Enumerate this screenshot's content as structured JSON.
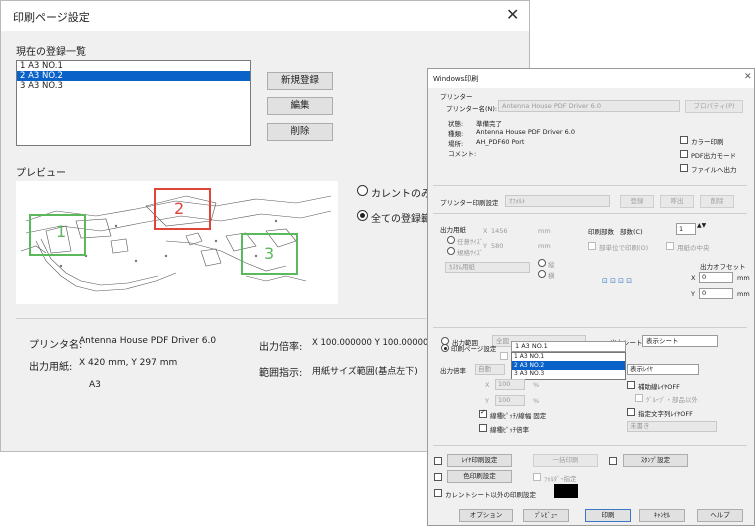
{
  "dialog_main": {
    "title": "印刷ページ設定",
    "close_icon": "close-icon",
    "list_heading": "現在の登録一覧",
    "list_items": [
      "1  A3  NO.1",
      "2  A3  NO.2",
      "3  A3  NO.3"
    ],
    "selected_index": 1,
    "buttons": {
      "new": "新規登録",
      "edit": "編集",
      "delete": "削除"
    },
    "preview_label": "プレビュー",
    "radio_current_only": "カレントのみ表",
    "radio_all": "全ての登録範",
    "markers": [
      "1",
      "2",
      "3"
    ],
    "marker_colors": {
      "1": "#5cb85c",
      "2": "#e0453a",
      "3": "#5cb85c"
    },
    "info": {
      "printer_label": "プリンタ名:",
      "printer_value": "Antenna House PDF Driver 6.0",
      "paper_label": "出力用紙:",
      "paper_value": "X 420 mm, Y 297 mm",
      "paper_size": "A3",
      "scale_label": "出力倍率:",
      "scale_value": "X 100.000000 Y 100.000000",
      "range_label": "範囲指示:",
      "range_value": "用紙サイズ範囲(基点左下)"
    }
  },
  "dialog_print": {
    "title": "Windows印刷",
    "close_icon": "close-icon",
    "printer_group": "プリンター",
    "printer_name_label": "プリンター名(N):",
    "printer_name_value": "Antenna House PDF Driver 6.0",
    "properties_button": "プロパティ(P)",
    "status_label": "状態:",
    "status_value": "準備完了",
    "type_label": "種類:",
    "type_value": "Antenna House PDF Driver 6.0",
    "location_label": "場所:",
    "location_value": "AH_PDF60 Port",
    "comment_label": "コメント:",
    "check_color": "カラー印刷",
    "check_pdf": "PDF出力モード",
    "check_file": "ファイルへ出力",
    "printer_preset_label": "プリンター印刷設定",
    "printer_preset_value": "ｵﾌｫﾙﾄ",
    "preset_buttons": [
      "登録",
      "呼出",
      "削除"
    ],
    "paper_label": "出力用紙",
    "paper_x_label": "X",
    "paper_x_value": "1456",
    "paper_unit": "mm",
    "paper_y_label": "Y",
    "paper_y_value": "580",
    "free_size": "任意ｻｲｽﾞ",
    "custom_size": "規格ｻｲｽﾞ",
    "copies_label": "印刷部数",
    "copies_sublabel": "部数(C)",
    "copies_value": "1",
    "collate": "部単位で印刷(O)",
    "center": "用紙の中央",
    "paper_select": "ｶｽﾀﾑ用紙",
    "orient_portrait": "縦",
    "orient_landscape": "横",
    "offset_label": "出力オフセット",
    "offset_x": "0",
    "offset_y": "0",
    "offset_unit": "mm",
    "range_radio": "出力範囲",
    "range_value": "全図",
    "range_check": "印刷範囲を考慮",
    "sheet_label": "出力シート",
    "sheet_value": "表示シート",
    "page_setting_radio": "印刷ページ設定",
    "page_setting_value": "1  A3  NO.1",
    "dropdown_options": [
      "1  A3  NO.1",
      "2  A3  NO.2",
      "3  A3  NO.3"
    ],
    "dropdown_selected": 2,
    "scale_label": "出力倍率",
    "scale_value": "自動",
    "scale_x_label": "X",
    "scale_x_value": "100",
    "scale_y_label": "Y",
    "scale_y_value": "100",
    "percent": "%",
    "layer_value": "表示ﾚｲﾔ",
    "aux_line_off": "補助線ﾚｲﾔOFF",
    "group_part": "ｸﾞﾙｰﾌﾟ・部品以外",
    "line_pitch_fixed": "線種ﾋﾟｯﾁ/線幅 固定",
    "line_pitch_scale": "線種ﾋﾟｯﾁ倍率",
    "fixed_text_off": "指定文字列ﾚｲﾔOFF",
    "unwritten": "未書き",
    "layer_print_btn": "ﾚｲﾔ印刷設定",
    "batch_print_btn": "一括印刷",
    "stamp_btn": "ｽﾀﾝﾌﾟ設定",
    "color_print_btn": "色印刷設定",
    "folder_spec": "ﾌｫﾙﾀﾞｰ指定",
    "other_sheets": "カレントシート以外の印刷設定",
    "bottom_buttons": [
      "オプション",
      "ﾌﾟﾚﾋﾞｭｰ",
      "印刷",
      "ｷｬﾝｾﾙ",
      "ヘルプ"
    ]
  }
}
